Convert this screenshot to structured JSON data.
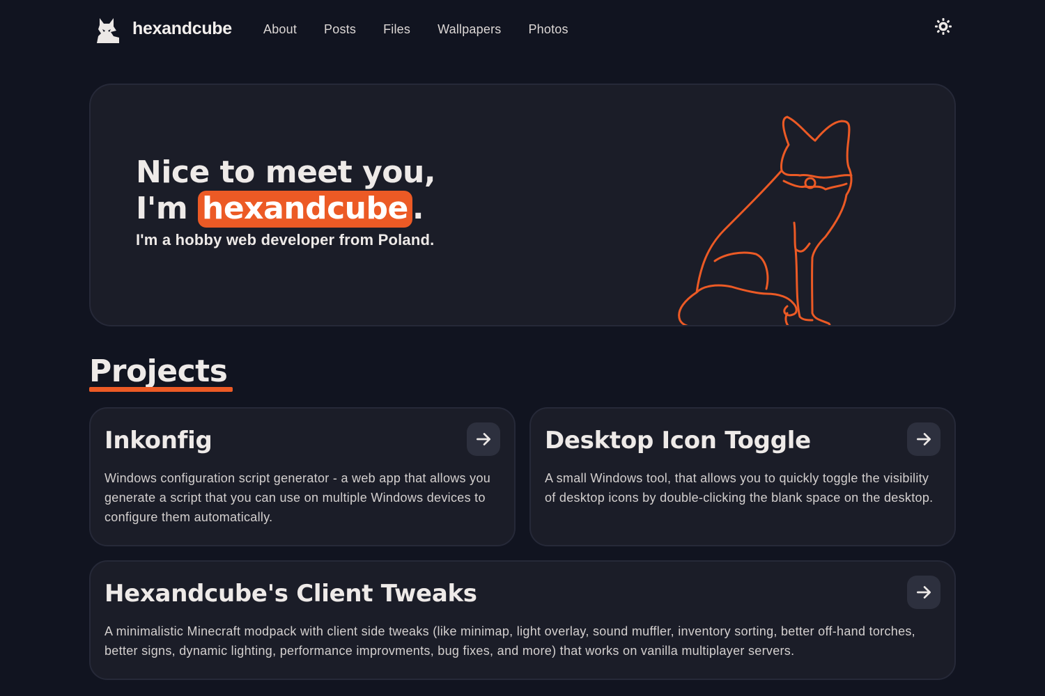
{
  "nav": {
    "brand": "hexandcube",
    "links": [
      "About",
      "Posts",
      "Files",
      "Wallpapers",
      "Photos"
    ],
    "logo_icon": "fox-logo-icon",
    "theme_icon": "sun-icon"
  },
  "hero": {
    "line1": "Nice to meet you,",
    "line2_prefix": "I'm ",
    "line2_highlight": "hexandcube",
    "line2_suffix": ".",
    "subtitle": "I'm a hobby web developer from Poland.",
    "illustration_icon": "fox-outline-illustration"
  },
  "projects": {
    "heading": "Projects",
    "items": [
      {
        "title": "Inkonfig",
        "description": "Windows configuration script generator - a web app that allows you generate a script that you can use on multiple Windows devices to configure them automatically.",
        "arrow_icon": "arrow-right-icon"
      },
      {
        "title": "Desktop Icon Toggle",
        "description": "A small Windows tool, that allows you to quickly toggle the visibility of desktop icons by double-clicking the blank space on the desktop.",
        "arrow_icon": "arrow-right-icon"
      },
      {
        "title": "Hexandcube's Client Tweaks",
        "description": "A minimalistic Minecraft modpack with client side tweaks (like minimap, light overlay, sound muffler, inventory sorting, better off-hand torches, better signs, dynamic lighting, performance improvments, bug fixes, and more) that works on vanilla multiplayer servers.",
        "arrow_icon": "arrow-right-icon"
      }
    ]
  },
  "colors": {
    "background": "#111420",
    "card": "#1b1d28",
    "accent": "#ec5a25",
    "text": "#eeeae8"
  }
}
